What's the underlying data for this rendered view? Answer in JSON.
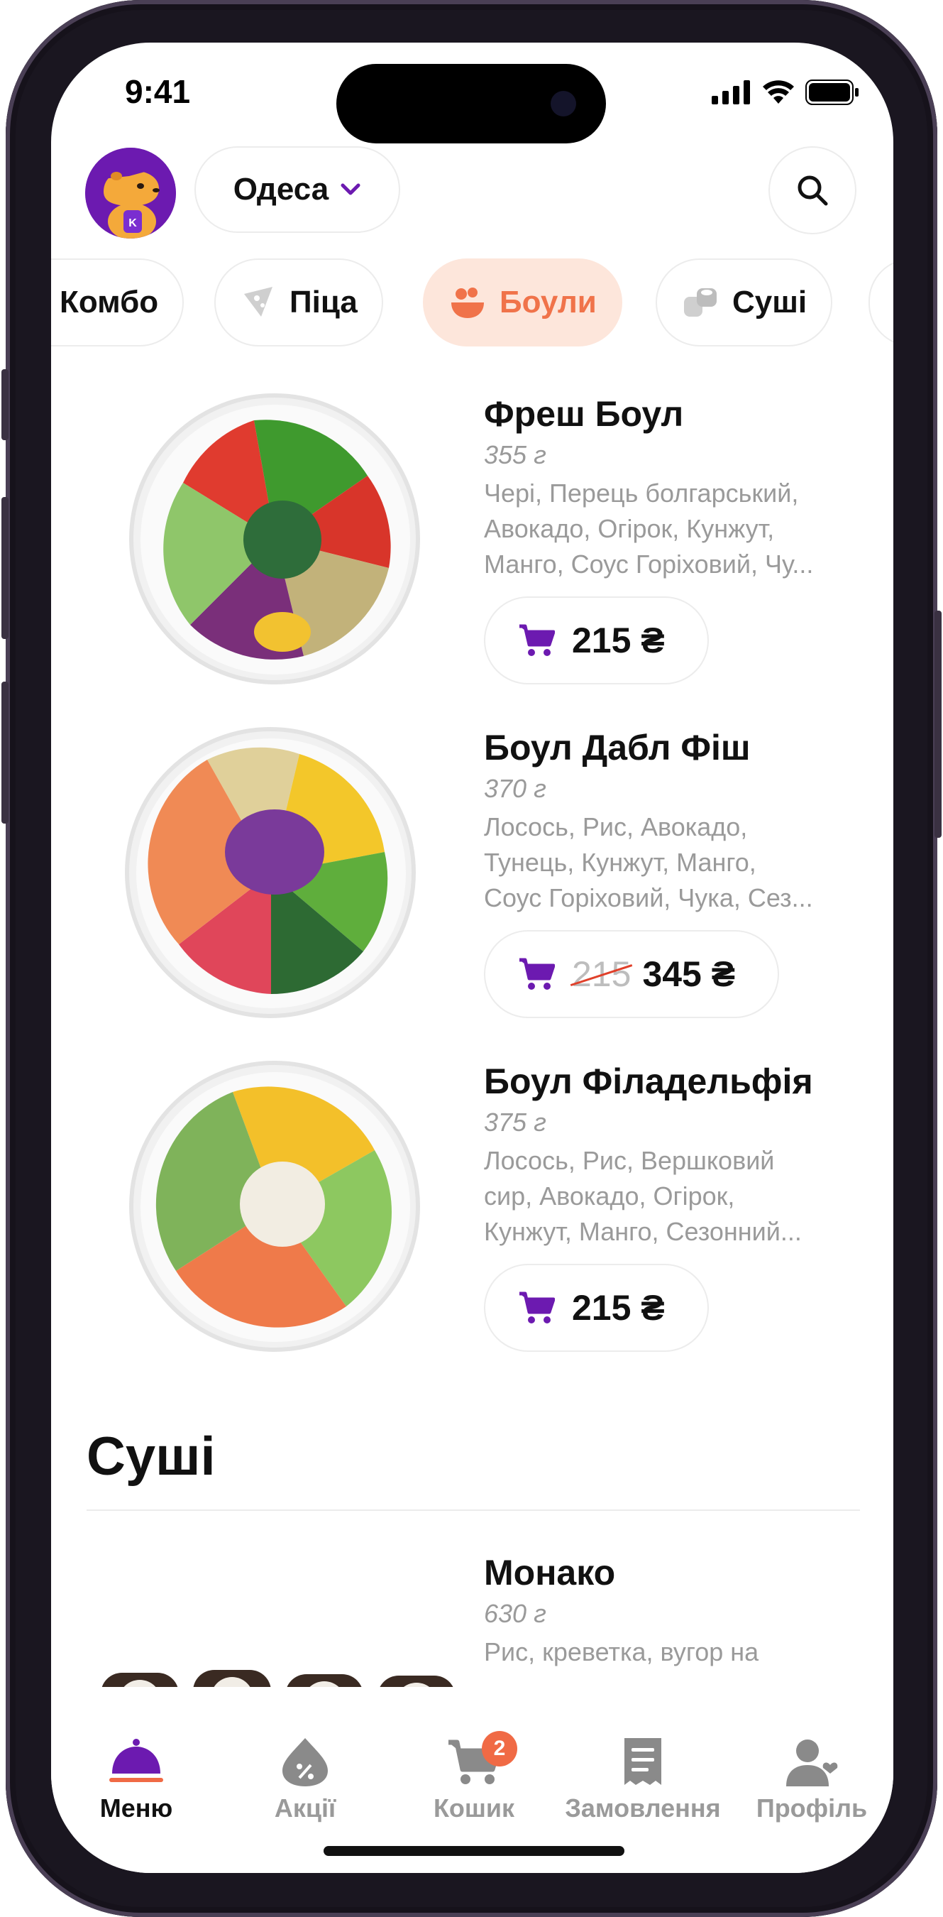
{
  "status": {
    "time": "9:41"
  },
  "header": {
    "city": "Одеса"
  },
  "categories": [
    {
      "label": "Комбо",
      "active": false
    },
    {
      "label": "Піца",
      "active": false
    },
    {
      "label": "Боули",
      "active": true
    },
    {
      "label": "Суші",
      "active": false
    }
  ],
  "products": [
    {
      "title": "Фреш Боул",
      "weight": "355 г",
      "desc": [
        "Чері, Перець болгарський,",
        "Авокадо, Огірок, Кунжут,",
        "Манго, Соус Горіховий, Чу..."
      ],
      "price": "215 ₴",
      "old_price": null
    },
    {
      "title": "Боул Дабл Фіш",
      "weight": "370 г",
      "desc": [
        "Лосось, Рис, Авокадо,",
        "Тунець, Кунжут, Манго,",
        "Соус Горіховий, Чука, Сез..."
      ],
      "price": "345 ₴",
      "old_price": "215"
    },
    {
      "title": "Боул Філадельфія",
      "weight": "375 г",
      "desc": [
        "Лосось, Рис, Вершковий",
        "сир, Авокадо, Огірок,",
        "Кунжут, Манго, Сезонний..."
      ],
      "price": "215 ₴",
      "old_price": null
    }
  ],
  "section": {
    "title": "Суші"
  },
  "sushi_product": {
    "title": "Монако",
    "weight": "630 г",
    "desc": [
      "Рис, креветка, вугор на"
    ]
  },
  "tabbar": {
    "items": [
      {
        "label": "Меню",
        "icon": "cloche-icon",
        "active": true
      },
      {
        "label": "Акції",
        "icon": "discount-icon",
        "active": false
      },
      {
        "label": "Кошик",
        "icon": "cart-icon",
        "active": false,
        "badge": "2"
      },
      {
        "label": "Замовлення",
        "icon": "receipt-icon",
        "active": false
      },
      {
        "label": "Профіль",
        "icon": "profile-icon",
        "active": false
      }
    ]
  },
  "colors": {
    "accent": "#6c1ab0",
    "orange": "#f06a45",
    "chip_active_bg": "#fde6db"
  }
}
